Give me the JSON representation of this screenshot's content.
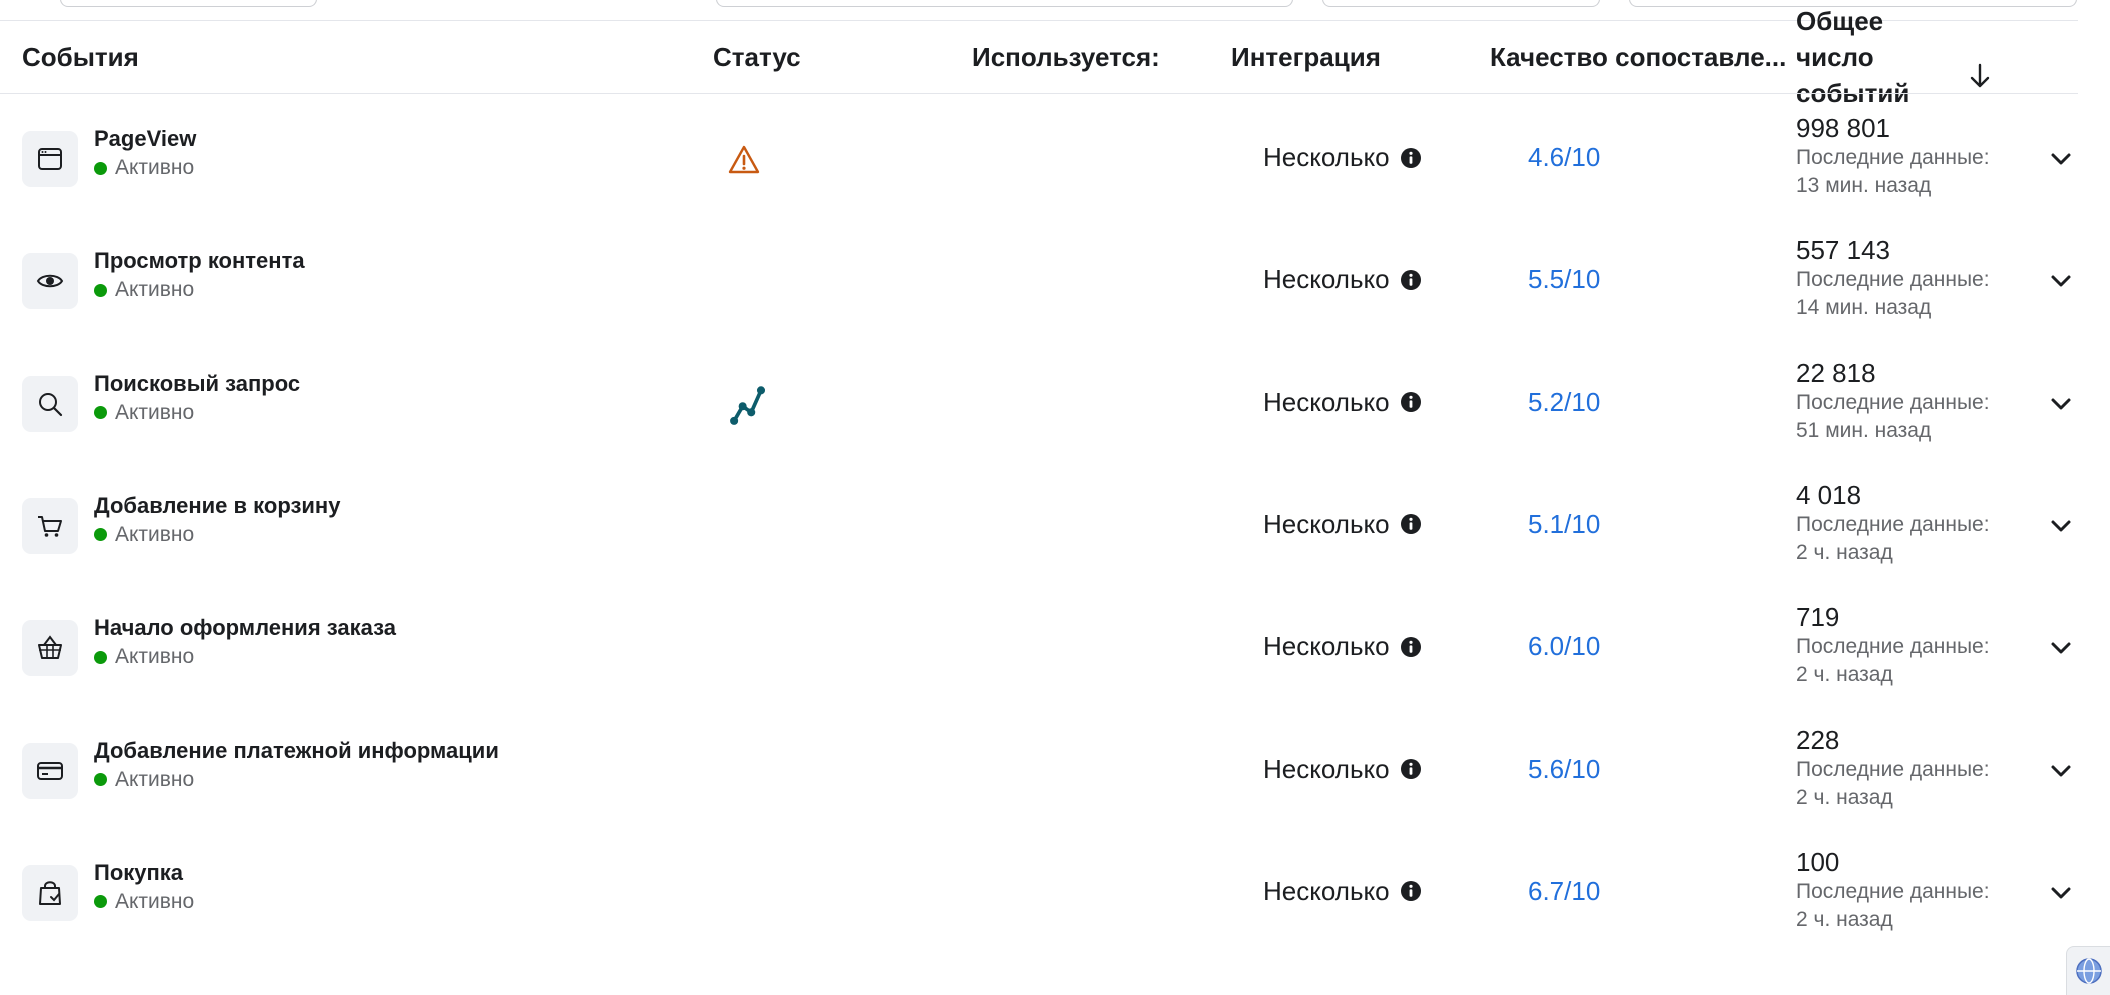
{
  "header": {
    "events": "События",
    "status": "Статус",
    "used": "Используется:",
    "integration": "Интеграция",
    "quality": "Качество сопоставле...",
    "total": "Общее число событий"
  },
  "colors": {
    "active": "#0b9a0b",
    "link": "#216fdb",
    "warning": "#c85a12",
    "activity": "#0d5c6b"
  },
  "rows": [
    {
      "name": "PageView",
      "icon": "browser-window-icon",
      "status": "Активно",
      "status_icon": "warning-icon",
      "integration": "Несколько",
      "quality": "4.6/10",
      "count": "998 801",
      "last_label": "Последние данные:",
      "last_time": "13 мин. назад"
    },
    {
      "name": "Просмотр контента",
      "icon": "eye-icon",
      "status": "Активно",
      "status_icon": "",
      "integration": "Несколько",
      "quality": "5.5/10",
      "count": "557 143",
      "last_label": "Последние данные:",
      "last_time": "14 мин. назад"
    },
    {
      "name": "Поисковый запрос",
      "icon": "search-icon",
      "status": "Активно",
      "status_icon": "activity-graph-icon",
      "integration": "Несколько",
      "quality": "5.2/10",
      "count": "22 818",
      "last_label": "Последние данные:",
      "last_time": "51 мин. назад"
    },
    {
      "name": "Добавление в корзину",
      "icon": "cart-icon",
      "status": "Активно",
      "status_icon": "",
      "integration": "Несколько",
      "quality": "5.1/10",
      "count": "4 018",
      "last_label": "Последние данные:",
      "last_time": "2 ч. назад"
    },
    {
      "name": "Начало оформления заказа",
      "icon": "basket-icon",
      "status": "Активно",
      "status_icon": "",
      "integration": "Несколько",
      "quality": "6.0/10",
      "count": "719",
      "last_label": "Последние данные:",
      "last_time": "2 ч. назад"
    },
    {
      "name": "Добавление платежной информации",
      "icon": "credit-card-icon",
      "status": "Активно",
      "status_icon": "",
      "integration": "Несколько",
      "quality": "5.6/10",
      "count": "228",
      "last_label": "Последние данные:",
      "last_time": "2 ч. назад"
    },
    {
      "name": "Покупка",
      "icon": "shopping-bag-icon",
      "status": "Активно",
      "status_icon": "",
      "integration": "Несколько",
      "quality": "6.7/10",
      "count": "100",
      "last_label": "Последние данные:",
      "last_time": "2 ч. назад"
    }
  ]
}
